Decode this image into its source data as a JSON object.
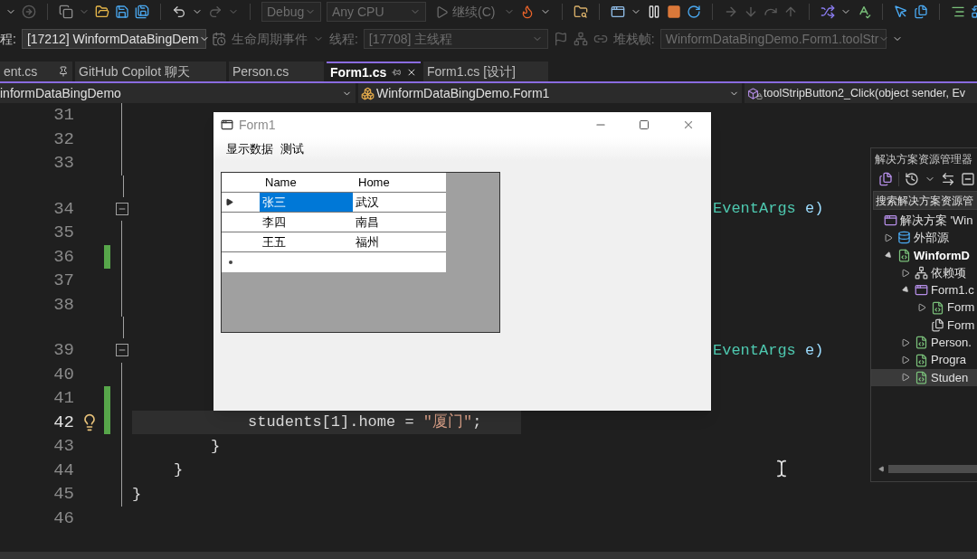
{
  "toolbar": {
    "configuration": {
      "value": "Debug",
      "disabled": true
    },
    "platform": {
      "value": "Any CPU",
      "disabled": true
    },
    "continue_button": {
      "label": "继续(C)"
    }
  },
  "debug_bar": {
    "process_label": "程:",
    "process": {
      "value": "[17212] WinformDataBingDem",
      "disabled": false
    },
    "lifecycle_events": "生命周期事件",
    "thread_label": "线程:",
    "thread": {
      "value": "[17708] 主线程",
      "disabled": true
    },
    "stack_frame_label": "堆栈帧:",
    "stack_frame": {
      "value": "WinformDataBingDemo.Form1.toolStr",
      "disabled": true
    }
  },
  "tabs": [
    {
      "label": "ent.cs",
      "selected": false,
      "pinned": true
    },
    {
      "label": "GitHub Copilot 聊天",
      "selected": false,
      "pinned": false
    },
    {
      "label": "Person.cs",
      "selected": false,
      "pinned": false
    },
    {
      "label": "Form1.cs",
      "selected": true,
      "pinned": false
    },
    {
      "label": "Form1.cs [设计]",
      "selected": false,
      "pinned": false
    }
  ],
  "navigation_bar": {
    "project": "informDataBingDemo",
    "type": "WinformDataBingDemo.Form1",
    "member": "toolStripButton2_Click(object sender, Ev"
  },
  "editor": {
    "lines": [
      {
        "number": "31",
        "kind": "code",
        "changed": false,
        "current": false
      },
      {
        "number": "32",
        "kind": "code",
        "changed": false,
        "current": false
      },
      {
        "number": "33",
        "kind": "code",
        "changed": false,
        "current": false
      },
      {
        "number": "34",
        "kind": "method",
        "changed": false,
        "current": false,
        "tokens": [
          {
            "text": "EventArgs",
            "kind": "type"
          },
          {
            "text": " e)",
            "kind": "param"
          }
        ]
      },
      {
        "number": "35",
        "kind": "code",
        "changed": false,
        "current": false
      },
      {
        "number": "36",
        "kind": "code",
        "changed": true,
        "current": false
      },
      {
        "number": "37",
        "kind": "code",
        "changed": false,
        "current": false
      },
      {
        "number": "38",
        "kind": "code",
        "changed": false,
        "current": false
      },
      {
        "number": "39",
        "kind": "method",
        "changed": false,
        "current": false,
        "tokens": [
          {
            "text": "EventArgs",
            "kind": "type"
          },
          {
            "text": " e)",
            "kind": "param"
          }
        ]
      },
      {
        "number": "40",
        "kind": "code",
        "changed": false,
        "current": false
      },
      {
        "number": "41",
        "kind": "code",
        "changed": true,
        "current": false
      },
      {
        "number": "42",
        "kind": "code",
        "changed": true,
        "current": true,
        "lightbulb": true,
        "tokens": [
          {
            "text": "students[1].home = ",
            "kind": "plain"
          },
          {
            "text": "\"厦门\"",
            "kind": "string"
          },
          {
            "text": ";",
            "kind": "plain"
          }
        ]
      },
      {
        "number": "43",
        "kind": "code",
        "changed": false,
        "current": false,
        "tokens": [
          {
            "text": "}",
            "kind": "plain"
          }
        ]
      },
      {
        "number": "44",
        "kind": "code",
        "changed": false,
        "current": false,
        "tokens": [
          {
            "text": "}",
            "kind": "plain"
          }
        ]
      },
      {
        "number": "45",
        "kind": "code",
        "changed": false,
        "current": false,
        "tokens": [
          {
            "text": "}",
            "kind": "plain"
          }
        ]
      },
      {
        "number": "46",
        "kind": "code",
        "changed": false,
        "current": false
      }
    ]
  },
  "form_window": {
    "title": "Form1",
    "menu": [
      "显示数据",
      "测试"
    ],
    "grid": {
      "columns": [
        "Name",
        "Home"
      ],
      "rows": [
        {
          "current": true,
          "cells": [
            {
              "text": "张三",
              "selected": true
            },
            {
              "text": "武汉",
              "selected": false
            }
          ]
        },
        {
          "current": false,
          "cells": [
            {
              "text": "李四",
              "selected": false
            },
            {
              "text": "南昌",
              "selected": false
            }
          ]
        },
        {
          "current": false,
          "cells": [
            {
              "text": "王五",
              "selected": false
            },
            {
              "text": "福州",
              "selected": false
            }
          ]
        }
      ],
      "new_row": true
    }
  },
  "solution_explorer": {
    "title": "解决方案资源管理器",
    "search": {
      "placeholder": "搜索解决方案资源管"
    },
    "tree": [
      {
        "label": "解决方案 'Win",
        "kind": "solution",
        "selected": false,
        "children": [
          {
            "label": "外部源",
            "kind": "external",
            "selected": false,
            "expanded": false
          },
          {
            "label": "WinformD",
            "kind": "project",
            "selected": false,
            "expanded": true,
            "children": [
              {
                "label": "依赖项",
                "kind": "dependencies",
                "selected": false,
                "expanded": false
              },
              {
                "label": "Form1.c",
                "kind": "form",
                "selected": false,
                "expanded": true,
                "children": [
                  {
                    "label": "Form",
                    "kind": "csharp",
                    "selected": false,
                    "expanded": false
                  },
                  {
                    "label": "Form",
                    "kind": "resx",
                    "selected": false
                  }
                ]
              },
              {
                "label": "Person.",
                "kind": "csharp",
                "selected": false,
                "expanded": false
              },
              {
                "label": "Progra",
                "kind": "csharp",
                "selected": false,
                "expanded": false
              },
              {
                "label": "Studen",
                "kind": "csharp",
                "selected": true,
                "expanded": false
              }
            ]
          }
        ]
      }
    ]
  }
}
